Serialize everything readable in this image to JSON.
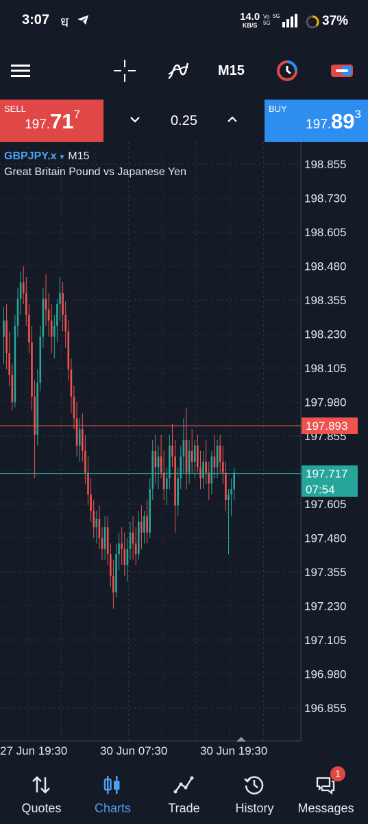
{
  "status_bar": {
    "time": "3:07",
    "hindi_char": "ध",
    "net_speed": "14.0",
    "net_unit": "KB/S",
    "volte": "Vo",
    "volte2": "5G",
    "network": "5G",
    "battery": "37%"
  },
  "toolbar": {
    "timeframe": "M15",
    "icons": [
      "menu-icon",
      "crosshair-icon",
      "indicators-icon",
      "timeframe-selector",
      "chart-type-icon",
      "trade-toggle-icon"
    ]
  },
  "trade_panel": {
    "sell": {
      "label": "SELL",
      "price_small": "197.",
      "price_big": "71",
      "price_sup": "7",
      "color": "#e04848"
    },
    "buy": {
      "label": "BUY",
      "price_small": "197.",
      "price_big": "89",
      "price_sup": "3",
      "color": "#2e8ef0"
    },
    "volume": "0.25"
  },
  "chart": {
    "symbol": "GBPJPY.x",
    "timeframe": "M15",
    "description": "Great Britain Pound vs Japanese Yen",
    "bid_label": "197.893",
    "ask_label": "197.717",
    "countdown": "07:54",
    "colors": {
      "up": "#26a69a",
      "down": "#ef5350",
      "bid_line": "#ef5350",
      "ask_line": "#26a69a",
      "grid": "#2a3444",
      "background": "#141b26"
    }
  },
  "chart_data": {
    "type": "candlestick",
    "title": "",
    "y_ticks": [
      "198.855",
      "198.730",
      "198.605",
      "198.480",
      "198.355",
      "198.230",
      "198.105",
      "197.980",
      "197.855",
      "197.730",
      "197.605",
      "197.480",
      "197.355",
      "197.230",
      "197.105",
      "196.980",
      "196.855"
    ],
    "ylim": [
      196.78,
      198.93
    ],
    "x_ticks": [
      "27 Jun 19:30",
      "30 Jun 07:30",
      "30 Jun 19:30"
    ],
    "x_tick_index": [
      0,
      48,
      96
    ],
    "current_bid": 197.893,
    "current_ask": 197.717,
    "ohlc": [
      [
        198.22,
        198.33,
        198.12,
        198.28
      ],
      [
        198.28,
        198.34,
        198.1,
        198.16
      ],
      [
        198.16,
        198.24,
        198.04,
        198.08
      ],
      [
        198.08,
        198.12,
        197.95,
        197.98
      ],
      [
        197.98,
        198.3,
        197.96,
        198.26
      ],
      [
        198.26,
        198.4,
        198.22,
        198.36
      ],
      [
        198.36,
        198.46,
        198.3,
        198.42
      ],
      [
        198.42,
        198.48,
        198.34,
        198.38
      ],
      [
        198.38,
        198.44,
        198.26,
        198.3
      ],
      [
        198.3,
        198.34,
        198.16,
        198.2
      ],
      [
        198.2,
        198.26,
        197.95,
        198.0
      ],
      [
        198.0,
        198.06,
        197.7,
        197.86
      ],
      [
        197.86,
        198.1,
        197.82,
        198.05
      ],
      [
        198.05,
        198.26,
        198.02,
        198.22
      ],
      [
        198.22,
        198.4,
        198.18,
        198.36
      ],
      [
        198.36,
        198.45,
        198.26,
        198.32
      ],
      [
        198.32,
        198.38,
        198.22,
        198.28
      ],
      [
        198.28,
        198.34,
        198.16,
        198.22
      ],
      [
        198.22,
        198.3,
        198.14,
        198.26
      ],
      [
        198.26,
        198.36,
        198.2,
        198.34
      ],
      [
        198.34,
        198.44,
        198.28,
        198.38
      ],
      [
        198.38,
        198.42,
        198.24,
        198.3
      ],
      [
        198.3,
        198.35,
        198.18,
        198.24
      ],
      [
        198.24,
        198.28,
        198.06,
        198.1
      ],
      [
        198.1,
        198.14,
        197.94,
        198.0
      ],
      [
        198.0,
        198.04,
        197.88,
        197.92
      ],
      [
        197.92,
        197.98,
        197.78,
        197.82
      ],
      [
        197.82,
        197.92,
        197.76,
        197.88
      ],
      [
        197.88,
        197.94,
        197.76,
        197.8
      ],
      [
        197.8,
        197.86,
        197.68,
        197.72
      ],
      [
        197.72,
        197.78,
        197.6,
        197.64
      ],
      [
        197.64,
        197.7,
        197.54,
        197.58
      ],
      [
        197.58,
        197.62,
        197.48,
        197.52
      ],
      [
        197.52,
        197.58,
        197.46,
        197.55
      ],
      [
        197.55,
        197.6,
        197.44,
        197.48
      ],
      [
        197.48,
        197.52,
        197.4,
        197.44
      ],
      [
        197.44,
        197.56,
        197.4,
        197.52
      ],
      [
        197.52,
        197.56,
        197.38,
        197.42
      ],
      [
        197.42,
        197.46,
        197.3,
        197.34
      ],
      [
        197.34,
        197.4,
        197.22,
        197.28
      ],
      [
        197.28,
        197.46,
        197.26,
        197.42
      ],
      [
        197.42,
        197.5,
        197.36,
        197.46
      ],
      [
        197.46,
        197.52,
        197.38,
        197.44
      ],
      [
        197.44,
        197.5,
        197.34,
        197.38
      ],
      [
        197.38,
        197.48,
        197.32,
        197.44
      ],
      [
        197.44,
        197.54,
        197.4,
        197.5
      ],
      [
        197.5,
        197.56,
        197.4,
        197.46
      ],
      [
        197.46,
        197.52,
        197.38,
        197.42
      ],
      [
        197.42,
        197.58,
        197.4,
        197.54
      ],
      [
        197.54,
        197.6,
        197.44,
        197.5
      ],
      [
        197.5,
        197.58,
        197.46,
        197.56
      ],
      [
        197.56,
        197.62,
        197.46,
        197.5
      ],
      [
        197.5,
        197.7,
        197.48,
        197.66
      ],
      [
        197.66,
        197.84,
        197.62,
        197.8
      ],
      [
        197.8,
        197.86,
        197.68,
        197.74
      ],
      [
        197.74,
        197.82,
        197.66,
        197.78
      ],
      [
        197.78,
        197.86,
        197.7,
        197.72
      ],
      [
        197.72,
        197.8,
        197.62,
        197.66
      ],
      [
        197.66,
        197.74,
        197.6,
        197.7
      ],
      [
        197.7,
        197.86,
        197.66,
        197.82
      ],
      [
        197.82,
        197.9,
        197.74,
        197.78
      ],
      [
        197.78,
        197.84,
        197.5,
        197.6
      ],
      [
        197.6,
        197.74,
        197.56,
        197.7
      ],
      [
        197.7,
        197.82,
        197.66,
        197.78
      ],
      [
        197.78,
        197.92,
        197.72,
        197.84
      ],
      [
        197.84,
        197.96,
        197.66,
        197.72
      ],
      [
        197.72,
        197.84,
        197.68,
        197.8
      ],
      [
        197.8,
        197.88,
        197.72,
        197.76
      ],
      [
        197.76,
        197.84,
        197.7,
        197.82
      ],
      [
        197.82,
        197.86,
        197.72,
        197.74
      ],
      [
        197.74,
        197.8,
        197.66,
        197.7
      ],
      [
        197.7,
        197.8,
        197.66,
        197.76
      ],
      [
        197.76,
        197.84,
        197.68,
        197.72
      ],
      [
        197.72,
        197.76,
        197.62,
        197.68
      ],
      [
        197.68,
        197.8,
        197.64,
        197.78
      ],
      [
        197.78,
        197.86,
        197.7,
        197.74
      ],
      [
        197.74,
        197.84,
        197.7,
        197.82
      ],
      [
        197.82,
        197.86,
        197.72,
        197.76
      ],
      [
        197.76,
        197.82,
        197.68,
        197.72
      ],
      [
        197.72,
        197.76,
        197.58,
        197.62
      ],
      [
        197.62,
        197.66,
        197.42,
        197.64
      ],
      [
        197.64,
        197.7,
        197.56,
        197.66
      ],
      [
        197.66,
        197.74,
        197.62,
        197.72
      ]
    ]
  },
  "bottom_nav": [
    {
      "label": "Quotes",
      "icon": "quotes-icon",
      "active": false
    },
    {
      "label": "Charts",
      "icon": "charts-icon",
      "active": true
    },
    {
      "label": "Trade",
      "icon": "trade-icon",
      "active": false
    },
    {
      "label": "History",
      "icon": "history-icon",
      "active": false
    },
    {
      "label": "Messages",
      "icon": "messages-icon",
      "active": false,
      "badge": "1"
    }
  ]
}
